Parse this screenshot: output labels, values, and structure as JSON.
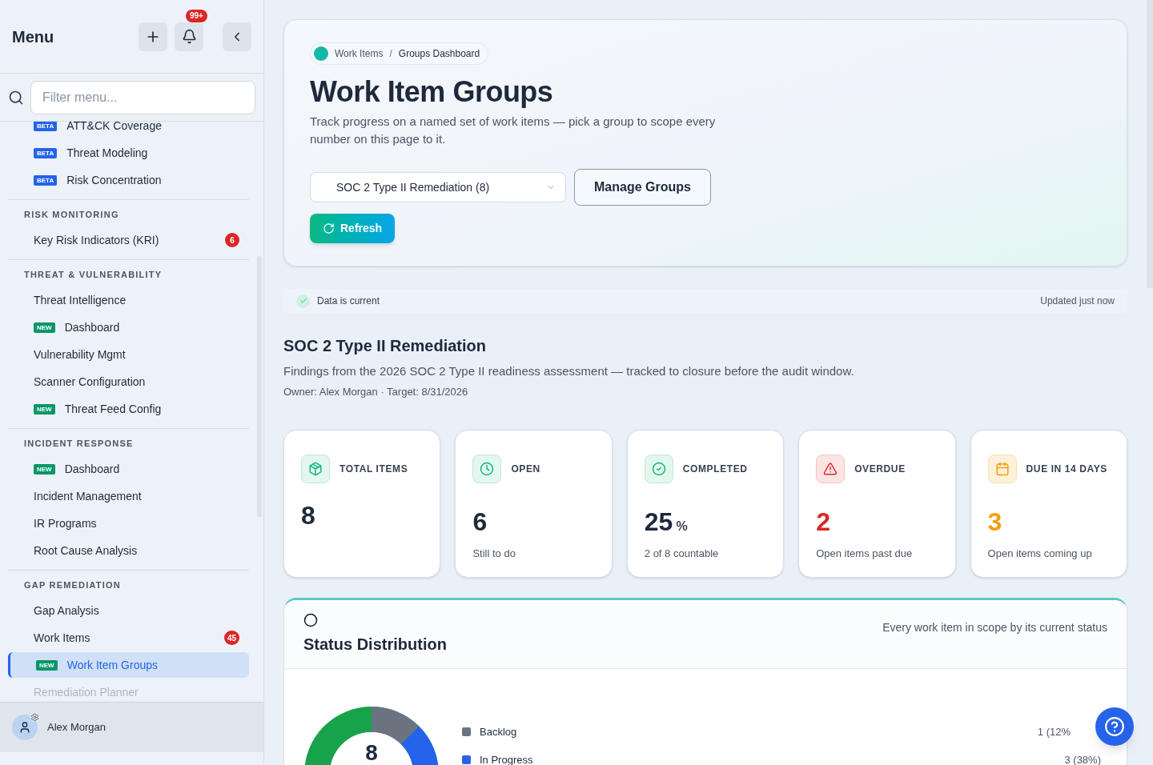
{
  "sidebar": {
    "title": "Menu",
    "notifications": "99+",
    "filter": {
      "placeholder": "Filter menu..."
    },
    "sections": [
      {
        "items": [
          {
            "label": "ATT&CK Coverage",
            "tag": "BETA",
            "color": "#2563eb",
            "selected": false
          },
          {
            "label": "Threat Modeling",
            "tag": "BETA",
            "color": "#2563eb",
            "selected": false
          },
          {
            "label": "Risk Concentration",
            "tag": "BETA",
            "color": "#2563eb",
            "selected": false
          }
        ]
      },
      {
        "title": "RISK MONITORING",
        "items": [
          {
            "label": "Key Risk Indicators (KRI)",
            "count": "6",
            "selected": false
          }
        ]
      },
      {
        "title": "THREAT & VULNERABILITY",
        "items": [
          {
            "label": "Threat Intelligence",
            "selected": false
          },
          {
            "label": "Dashboard",
            "tag": "NEW",
            "color": "#059669",
            "selected": false
          },
          {
            "label": "Vulnerability Mgmt",
            "selected": false
          },
          {
            "label": "Scanner Configuration",
            "selected": false
          },
          {
            "label": "Threat Feed Config",
            "tag": "NEW",
            "color": "#059669",
            "selected": false
          }
        ]
      },
      {
        "title": "INCIDENT RESPONSE",
        "items": [
          {
            "label": "Dashboard",
            "tag": "NEW",
            "color": "#059669",
            "selected": false
          },
          {
            "label": "Incident Management",
            "selected": false
          },
          {
            "label": "IR Programs",
            "selected": false
          },
          {
            "label": "Root Cause Analysis",
            "selected": false
          }
        ]
      },
      {
        "title": "GAP REMEDIATION",
        "items": [
          {
            "label": "Gap Analysis",
            "selected": false
          },
          {
            "label": "Work Items",
            "count": "45",
            "selected": false
          },
          {
            "label": "Work Item Groups",
            "tag": "NEW",
            "color": "#059669",
            "selected": true
          },
          {
            "label": "Remediation Planner",
            "selected": false,
            "faded": true
          }
        ]
      }
    ],
    "user": "Alex Morgan"
  },
  "header": {
    "breadcrumb": [
      "Work Items",
      "Groups Dashboard"
    ],
    "breadcrumb_separator": "/",
    "title": "Work Item Groups",
    "subtitle": "Track progress on a named set of work items — pick a group to scope every number on this page to it.",
    "group_select": "SOC 2 Type II Remediation (8)",
    "manage_button": "Manage Groups",
    "refresh_button": "Refresh"
  },
  "status_bar": {
    "message": "Data is current",
    "updated": "Updated just now"
  },
  "group": {
    "name": "SOC 2 Type II Remediation",
    "description": "Findings from the 2026 SOC 2 Type II readiness assessment — tracked to closure before the audit window.",
    "meta": "Owner: Alex Morgan · Target: 8/31/2026"
  },
  "stats": [
    {
      "kind": "total",
      "label": "TOTAL ITEMS",
      "value": "8"
    },
    {
      "kind": "open",
      "label": "OPEN",
      "value": "6",
      "note": "Still to do"
    },
    {
      "kind": "completed",
      "label": "COMPLETED",
      "value": "25",
      "unit": "%",
      "note": "2 of 8 countable"
    },
    {
      "kind": "overdue",
      "label": "OVERDUE",
      "value": "2",
      "note": "Open items past due"
    },
    {
      "kind": "due",
      "label": "DUE IN 14 DAYS",
      "value": "3",
      "note": "Open items coming up"
    }
  ],
  "status_distribution": {
    "title": "Status Distribution",
    "caption": "Every work item in scope by its current status",
    "total": "8",
    "legend": [
      {
        "label": "Backlog",
        "reading": "1 (12%",
        "color": "#6b7280"
      },
      {
        "label": "In Progress",
        "reading": "3 (38%)",
        "color": "#2563eb"
      }
    ]
  }
}
